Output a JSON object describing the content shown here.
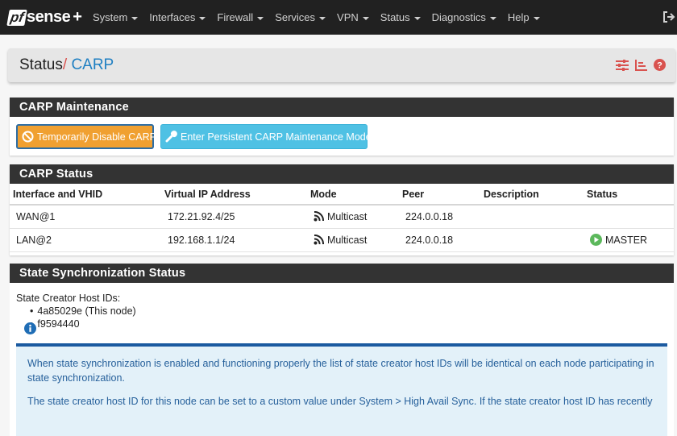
{
  "navbar": {
    "logo_pf": "pf",
    "logo_sense": "sense",
    "logo_plus": "+",
    "menu": [
      "System",
      "Interfaces",
      "Firewall",
      "Services",
      "VPN",
      "Status",
      "Diagnostics",
      "Help"
    ],
    "logout_icon": "sign-out-icon"
  },
  "header": {
    "crumb_base": "Status",
    "separator": "/",
    "crumb_current": "CARP",
    "icons": [
      "sliders-icon",
      "chart-icon",
      "help-icon"
    ]
  },
  "maintenance": {
    "title": "CARP Maintenance",
    "disable_button": "Temporarily Disable CARP",
    "persistent_button": "Enter Persistent CARP Maintenance Mode"
  },
  "carp_status": {
    "title": "CARP Status",
    "columns": [
      "Interface and VHID",
      "Virtual IP Address",
      "Mode",
      "Peer",
      "Description",
      "Status"
    ],
    "rows": [
      {
        "iface": "WAN@1",
        "vip": "172.21.92.4/25",
        "mode": "Multicast",
        "peer": "224.0.0.18",
        "description": "",
        "status": ""
      },
      {
        "iface": "LAN@2",
        "vip": "192.168.1.1/24",
        "mode": "Multicast",
        "peer": "224.0.0.18",
        "description": "",
        "status": "MASTER"
      }
    ]
  },
  "sync": {
    "title": "State Synchronization Status",
    "label": "State Creator Host IDs:",
    "ids": [
      "4a85029e (This node)",
      "f9594440"
    ],
    "info_p1": "When state synchronization is enabled and functioning properly the list of state creator host IDs will be identical on each node participating in state synchronization.",
    "info_p2": "The state creator host ID for this node can be set to a custom value under System > High Avail Sync. If the state creator host ID has recently"
  },
  "colors": {
    "navbar": "#212121",
    "accent_red": "#d9534f",
    "link_blue": "#1e7fc2",
    "warning": "#f0a031",
    "info": "#4fc1e4",
    "success": "#5cb85c"
  }
}
